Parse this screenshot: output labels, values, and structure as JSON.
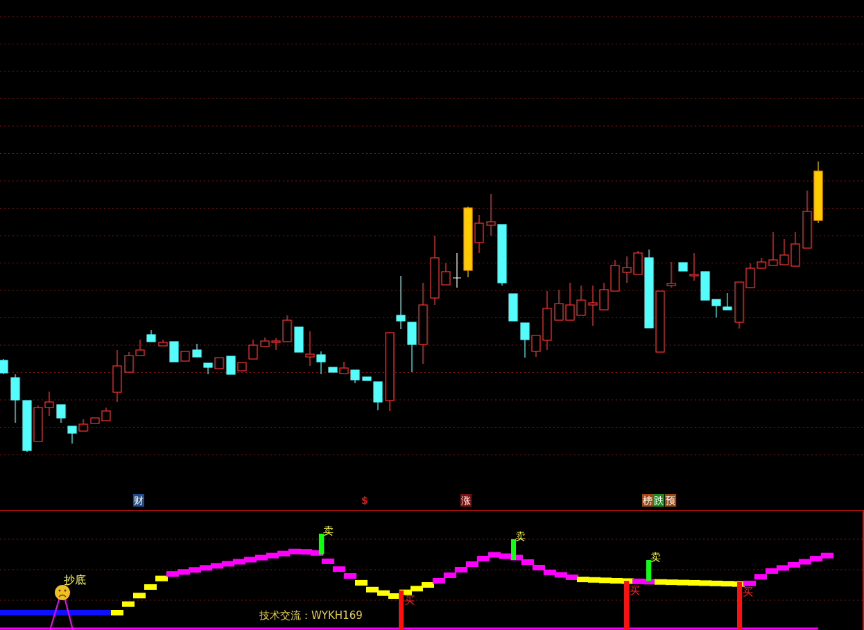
{
  "main_chart": {
    "markers": [
      {
        "label": "财",
        "kind": "badge",
        "color": "#1f4d8c"
      },
      {
        "label": "$",
        "kind": "plain",
        "color": "#e01818"
      },
      {
        "label": "涨",
        "kind": "badge",
        "color": "#7a1010"
      },
      {
        "label": "榜",
        "kind": "badge",
        "color": "#9a4a12"
      },
      {
        "label": "跌",
        "kind": "badge",
        "color": "#1e8a1e"
      },
      {
        "label": "预",
        "kind": "badge",
        "color": "#9a4a12"
      }
    ]
  },
  "indicator": {
    "bottom_label": "抄底",
    "note": "技术交流：WYKH169",
    "signals": [
      {
        "kind": "sell",
        "label": "卖"
      },
      {
        "kind": "buy",
        "label": "买"
      },
      {
        "kind": "sell",
        "label": "卖"
      },
      {
        "kind": "buy",
        "label": "买"
      },
      {
        "kind": "sell",
        "label": "卖"
      },
      {
        "kind": "buy",
        "label": "买"
      }
    ]
  }
}
